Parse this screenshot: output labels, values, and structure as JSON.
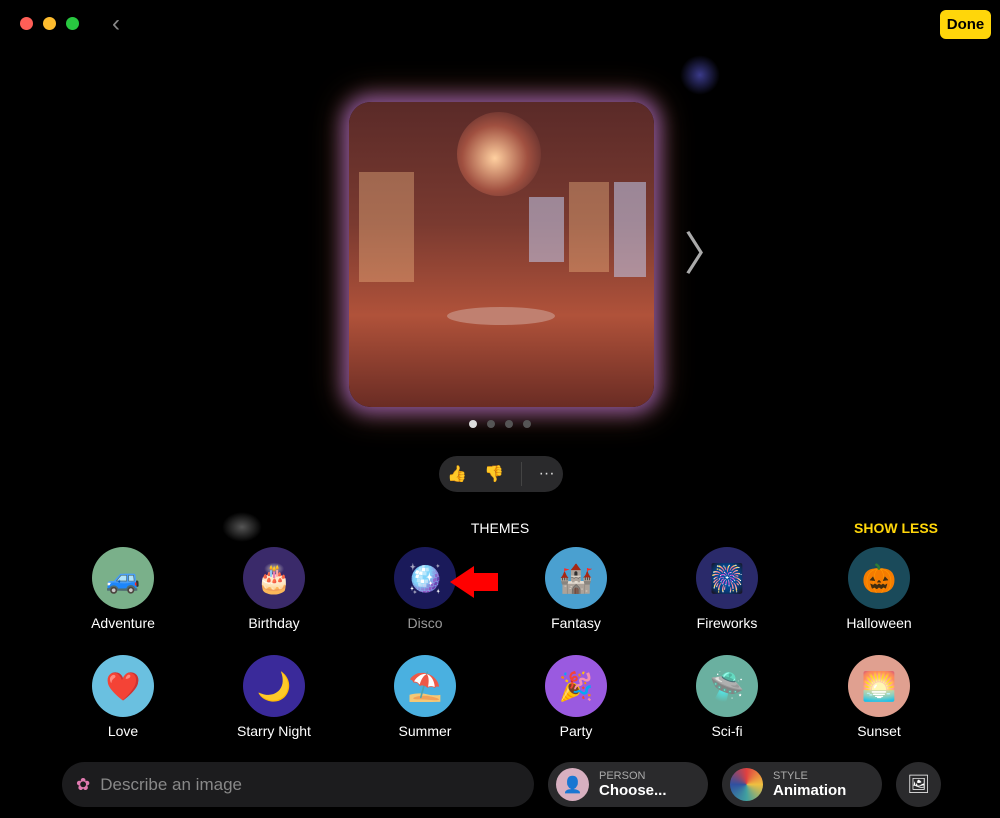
{
  "window": {
    "traffic_lights": [
      "#ff5f57",
      "#febc2e",
      "#28c840"
    ],
    "back_icon": "chevron-left-icon",
    "done_label": "Done"
  },
  "preview": {
    "page_count": 4,
    "current_page": 1,
    "next_icon": "chevron-right-icon"
  },
  "feedback": {
    "thumbs_up": "👍",
    "thumbs_down": "👎",
    "more": "···"
  },
  "themes": {
    "title": "THEMES",
    "show_less": "SHOW LESS",
    "items": [
      {
        "label": "Adventure",
        "icon": "🚙",
        "bg": "#7ab08a"
      },
      {
        "label": "Birthday",
        "icon": "🎂",
        "bg": "#3a2a6a"
      },
      {
        "label": "Disco",
        "icon": "🪩",
        "bg": "#1a1a5a"
      },
      {
        "label": "Fantasy",
        "icon": "🏰",
        "bg": "#4aa0d0"
      },
      {
        "label": "Fireworks",
        "icon": "🎆",
        "bg": "#2a2a6a"
      },
      {
        "label": "Halloween",
        "icon": "🎃",
        "bg": "#1a4a5a"
      },
      {
        "label": "Love",
        "icon": "❤️",
        "bg": "#6ac0e0"
      },
      {
        "label": "Starry Night",
        "icon": "🌙",
        "bg": "#3a2a9a"
      },
      {
        "label": "Summer",
        "icon": "⛱️",
        "bg": "#4ab0e0"
      },
      {
        "label": "Party",
        "icon": "🎉",
        "bg": "#9a5ae0"
      },
      {
        "label": "Sci-fi",
        "icon": "🛸",
        "bg": "#6ab0a0"
      },
      {
        "label": "Sunset",
        "icon": "🌅",
        "bg": "#e0a090"
      }
    ]
  },
  "bottom": {
    "search_placeholder": "Describe an image",
    "person_label": "PERSON",
    "person_value": "Choose...",
    "style_label": "STYLE",
    "style_value": "Animation",
    "gallery_icon": "photo-library-icon"
  }
}
